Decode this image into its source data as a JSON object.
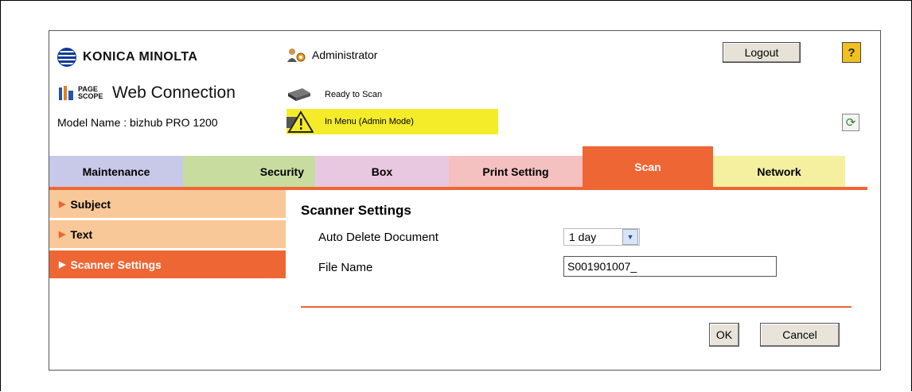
{
  "header": {
    "brand": "KONICA MINOLTA",
    "pagescope": "PAGE SCOPE",
    "product": "Web Connection",
    "model_name": "Model Name : bizhub PRO 1200",
    "user": "Administrator",
    "status_ready": "Ready to Scan",
    "status_menu": "In Menu (Admin Mode)",
    "logout_label": "Logout",
    "help_label": "?",
    "refresh_icon": "refresh-icon"
  },
  "tabs": [
    {
      "label": "Maintenance",
      "color": "#c8c8e8"
    },
    {
      "label": "Security",
      "color": "#c8dca0"
    },
    {
      "label": "Box",
      "color": "#e8c8e0"
    },
    {
      "label": "Print Setting",
      "color": "#f4c0c0"
    },
    {
      "label": "Scan",
      "color": "#ee6633",
      "active": true
    },
    {
      "label": "Network",
      "color": "#f4f0a0"
    }
  ],
  "menu": [
    {
      "label": "Subject",
      "active": false
    },
    {
      "label": "Text",
      "active": false
    },
    {
      "label": "Scanner Settings",
      "active": true
    }
  ],
  "content": {
    "title": "Scanner Settings",
    "auto_delete_label": "Auto Delete Document",
    "auto_delete_value": "1 day",
    "file_name_label": "File Name",
    "file_name_value": "S001901007_",
    "ok_label": "OK",
    "cancel_label": "Cancel"
  },
  "colors": {
    "accent": "#ee6633",
    "menu_inactive": "#f8c898",
    "status_highlight": "#f4ec28"
  }
}
